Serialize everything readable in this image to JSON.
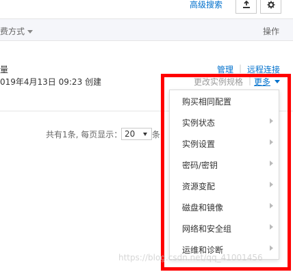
{
  "toolbar": {
    "advanced_search": "高级搜索",
    "export_icon": "export-icon",
    "settings_icon": "gear-icon"
  },
  "table": {
    "headers": {
      "billing_method": "费方式",
      "actions": "操作"
    },
    "row": {
      "quantity_text": "量",
      "created_text": "019年4月13日 09:23 创建",
      "actions": {
        "manage": "管理",
        "remote_connect": "远程连接",
        "change_spec": "更改实例规格",
        "more": "更多"
      }
    }
  },
  "pagination": {
    "label": "共有1条, 每页显示：",
    "page_size": "20",
    "suffix": "条"
  },
  "more_menu": {
    "items": [
      {
        "label": "购买相同配置",
        "has_submenu": false
      },
      {
        "label": "实例状态",
        "has_submenu": true
      },
      {
        "label": "实例设置",
        "has_submenu": true
      },
      {
        "label": "密码/密钥",
        "has_submenu": true
      },
      {
        "label": "资源变配",
        "has_submenu": true
      },
      {
        "label": "磁盘和镜像",
        "has_submenu": true
      },
      {
        "label": "网络和安全组",
        "has_submenu": true
      },
      {
        "label": "运维和诊断",
        "has_submenu": true
      }
    ]
  },
  "watermark": "https://blog.csdn.net/qq_41001456",
  "colors": {
    "link": "#0070cc",
    "highlight": "#ff0000",
    "header_bg": "#f5f6fa"
  }
}
